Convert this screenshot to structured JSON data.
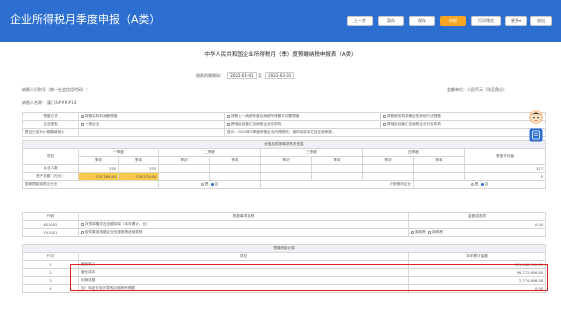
{
  "header": {
    "title": "企业所得税月季度申报（A类）",
    "buttons": [
      "上一步",
      "暂存",
      "保存",
      "申报",
      "打印预览",
      "更多",
      "退出"
    ],
    "more_arrow": "▾"
  },
  "form": {
    "title": "中华人民共和国企业所得税月（季）度预缴纳税申报表（A类）",
    "period_label": "税款所属期间：",
    "period_start": "2022-01-01",
    "period_to": "至",
    "period_end": "2022-03-31",
    "taxpayer_id_label": "纳税人识别号（统一社会信用代码）：",
    "amount_unit": "金额单位：人民币元（列至角分）",
    "taxpayer_name_label": "纳税人名称：",
    "taxpayer_name": "厦门4####14"
  },
  "top_rows": {
    "r1_label": "预缴方式",
    "r1_opt1": "按照实际利润额预缴",
    "r1_opt2": "按照上一纳税年度应纳税所得额平均额预缴",
    "r1_opt3": "按照税务机关确定的其他方法预缴",
    "r2_label": "企业类型",
    "r2_opt1": "一般企业",
    "r2_opt2": "跨地区经营汇总纳税企业总机构",
    "r2_opt3": "跨地区经营汇总纳税企业分支机构",
    "r3_label": "是否已成为小规模纳税人",
    "r3_warning": "提示：2023年4季度申报企业所得税时，请勿勾选本栏目在税申报。"
  },
  "preferential": {
    "section_title": "优惠及附报事项有关信息",
    "project_label": "项目",
    "quarters": [
      "一季度",
      "二季度",
      "三季度",
      "四季度"
    ],
    "avg_label": "季度平均值",
    "begin": "季初",
    "end": "季末",
    "employees_label": "从业人数",
    "employees_begin": "335",
    "employees_end": "333",
    "employees_avg": "377",
    "assets_label": "资产总额（万元）",
    "assets_begin": "170,169.44",
    "assets_end": "129,975.84",
    "assets_avg": "0",
    "restricted_label": "国家限制或禁止行业",
    "small_label": "小型微利企业",
    "yes": "是",
    "no": "否"
  },
  "attached": {
    "code_label": "代码",
    "name_label": "附报事项名称",
    "amount_label": "金额或选项",
    "rows": [
      {
        "code": "K01002",
        "name": "扶贫捐赠支出全额扣除（本年累计，元）",
        "value": "0.00"
      },
      {
        "code": "Y01001",
        "name": "软件集成电路企业优惠政策适用类型",
        "opt1": "原政策",
        "opt2": "新政策"
      }
    ]
  },
  "prepay": {
    "section_title": "预缴税款计算",
    "col_line": "行次",
    "col_item": "项目",
    "col_amount": "本年累计金额",
    "rows": [
      {
        "line": "1",
        "item": "营业收入",
        "amount": "121,148,912.09"
      },
      {
        "line": "2",
        "item": "营业成本",
        "amount": "96,772,656.80"
      },
      {
        "line": "3",
        "item": "利润总额",
        "amount": "2,774,698.58"
      },
      {
        "line": "4",
        "item": "加：特定业务计算的应纳税所得额",
        "amount": "0.00"
      }
    ]
  },
  "colors": {
    "brand": "#2d6fd1",
    "accent": "#f5a623",
    "highlight": "#f7c948",
    "alert": "#e02020"
  }
}
